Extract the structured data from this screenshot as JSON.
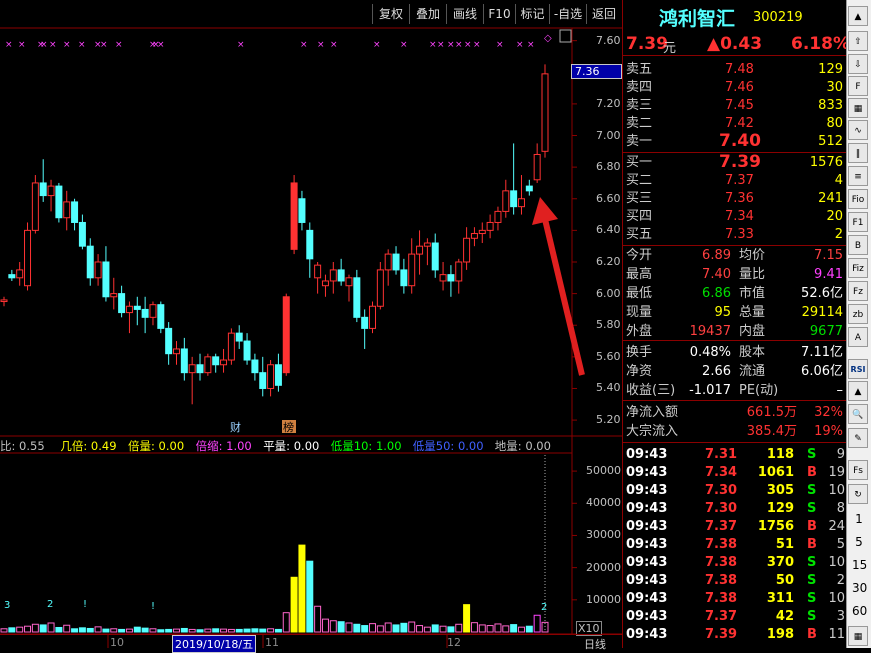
{
  "toolbar": {
    "buttons": [
      "复权",
      "叠加",
      "画线",
      "F10",
      "标记",
      "-自选",
      "返回"
    ]
  },
  "stock": {
    "name": "鸿利智汇",
    "code": "300219",
    "price": "7.39",
    "price_unit": "元",
    "change": "▲0.43",
    "change_pct": "6.18%"
  },
  "price_axis": {
    "ticks": [
      "7.60",
      "7.40",
      "7.20",
      "7.00",
      "6.80",
      "6.60",
      "6.40",
      "6.20",
      "6.00",
      "5.80",
      "5.60",
      "5.40",
      "5.20"
    ],
    "current_label": "7.36"
  },
  "volume_axis": {
    "ticks": [
      "50000",
      "40000",
      "30000",
      "20000",
      "10000"
    ],
    "unit": "X10"
  },
  "indicator_line": {
    "items": [
      {
        "label": "比: 0.55",
        "color": "#c0c0c0"
      },
      {
        "label": "几倍: 0.49",
        "color": "#ffff00"
      },
      {
        "label": "倍量: 0.00",
        "color": "#ffff00"
      },
      {
        "label": "倍缩: 1.00",
        "color": "#ff44ff"
      },
      {
        "label": "平量: 0.00",
        "color": "#ffffff"
      },
      {
        "label": "低量10: 1.00",
        "color": "#00ff00"
      },
      {
        "label": "低量50: 0.00",
        "color": "#4060ff"
      },
      {
        "label": "地量: 0.00",
        "color": "#c0c0c0"
      }
    ]
  },
  "chart_markers": {
    "cai": "财",
    "bang": "榜",
    "diamond": "◇",
    "vol_labels": [
      "3",
      "2",
      "!",
      "!",
      "2"
    ]
  },
  "date_axis": {
    "labels": [
      "10",
      "2019/10/18/五",
      "11",
      "12"
    ],
    "period": "日线"
  },
  "order_book": {
    "sell": [
      {
        "label": "卖五",
        "price": "7.48",
        "vol": "129"
      },
      {
        "label": "卖四",
        "price": "7.46",
        "vol": "30"
      },
      {
        "label": "卖三",
        "price": "7.45",
        "vol": "833"
      },
      {
        "label": "卖二",
        "price": "7.42",
        "vol": "80"
      },
      {
        "label": "卖一",
        "price": "7.40",
        "vol": "512"
      }
    ],
    "buy": [
      {
        "label": "买一",
        "price": "7.39",
        "vol": "1576"
      },
      {
        "label": "买二",
        "price": "7.37",
        "vol": "4"
      },
      {
        "label": "买三",
        "price": "7.36",
        "vol": "241"
      },
      {
        "label": "买四",
        "price": "7.34",
        "vol": "20"
      },
      {
        "label": "买五",
        "price": "7.33",
        "vol": "2"
      }
    ]
  },
  "stats": [
    {
      "l1": "今开",
      "v1": "6.89",
      "c1": "#ff4040",
      "l2": "均价",
      "v2": "7.15",
      "c2": "#ff4040"
    },
    {
      "l1": "最高",
      "v1": "7.40",
      "c1": "#ff4040",
      "l2": "量比",
      "v2": "9.41",
      "c2": "#ff40ff"
    },
    {
      "l1": "最低",
      "v1": "6.86",
      "c1": "#00e000",
      "l2": "市值",
      "v2": "52.6亿",
      "c2": "#ffffff"
    },
    {
      "l1": "现量",
      "v1": "95",
      "c1": "#ffff00",
      "l2": "总量",
      "v2": "29114",
      "c2": "#ffff00"
    },
    {
      "l1": "外盘",
      "v1": "19437",
      "c1": "#ff4040",
      "l2": "内盘",
      "v2": "9677",
      "c2": "#00e000"
    }
  ],
  "stats2": [
    {
      "l1": "换手",
      "v1": "0.48%",
      "l2": "股本",
      "v2": "7.11亿"
    },
    {
      "l1": "净资",
      "v1": "2.66",
      "l2": "流通",
      "v2": "6.06亿"
    },
    {
      "l1": "收益(三)",
      "v1": "-1.017",
      "l2": "PE(动)",
      "v2": "–"
    }
  ],
  "flows": [
    {
      "label": "净流入额",
      "value": "661.5万",
      "pct": "32%"
    },
    {
      "label": "大宗流入",
      "value": "385.4万",
      "pct": "19%"
    }
  ],
  "ticks": [
    {
      "time": "09:43",
      "price": "7.31",
      "vol": "118",
      "side": "S",
      "n": "9"
    },
    {
      "time": "09:43",
      "price": "7.34",
      "vol": "1061",
      "side": "B",
      "n": "19"
    },
    {
      "time": "09:43",
      "price": "7.30",
      "vol": "305",
      "side": "S",
      "n": "10"
    },
    {
      "time": "09:43",
      "price": "7.30",
      "vol": "129",
      "side": "S",
      "n": "8"
    },
    {
      "time": "09:43",
      "price": "7.37",
      "vol": "1756",
      "side": "B",
      "n": "24"
    },
    {
      "time": "09:43",
      "price": "7.38",
      "vol": "51",
      "side": "B",
      "n": "5"
    },
    {
      "time": "09:43",
      "price": "7.38",
      "vol": "370",
      "side": "S",
      "n": "10"
    },
    {
      "time": "09:43",
      "price": "7.38",
      "vol": "50",
      "side": "S",
      "n": "2"
    },
    {
      "time": "09:43",
      "price": "7.38",
      "vol": "311",
      "side": "S",
      "n": "10"
    },
    {
      "time": "09:43",
      "price": "7.37",
      "vol": "42",
      "side": "S",
      "n": "3"
    },
    {
      "time": "09:43",
      "price": "7.39",
      "vol": "198",
      "side": "B",
      "n": "11"
    }
  ],
  "side_nums": [
    "1",
    "5",
    "15",
    "30",
    "60"
  ],
  "colors": {
    "up": "#ff3232",
    "down": "#54ffff",
    "grid": "#8b0000",
    "arrow": "#e02020"
  },
  "chart_data": {
    "type": "candlestick",
    "ylim": [
      5.15,
      7.68
    ],
    "candles": [
      [
        5.95,
        5.98,
        5.92,
        5.96
      ],
      [
        6.12,
        6.15,
        6.08,
        6.1
      ],
      [
        6.1,
        6.2,
        6.05,
        6.15
      ],
      [
        6.05,
        6.45,
        6.02,
        6.4
      ],
      [
        6.4,
        6.75,
        6.38,
        6.7
      ],
      [
        6.7,
        6.85,
        6.58,
        6.62
      ],
      [
        6.62,
        6.72,
        6.52,
        6.68
      ],
      [
        6.68,
        6.7,
        6.45,
        6.48
      ],
      [
        6.48,
        6.65,
        6.4,
        6.58
      ],
      [
        6.58,
        6.6,
        6.4,
        6.45
      ],
      [
        6.45,
        6.5,
        6.28,
        6.3
      ],
      [
        6.3,
        6.35,
        6.05,
        6.1
      ],
      [
        6.1,
        6.25,
        6.05,
        6.2
      ],
      [
        6.2,
        6.3,
        5.95,
        5.98
      ],
      [
        5.98,
        6.1,
        5.9,
        6.0
      ],
      [
        6.0,
        6.05,
        5.85,
        5.88
      ],
      [
        5.88,
        5.95,
        5.75,
        5.92
      ],
      [
        5.92,
        5.98,
        5.8,
        5.9
      ],
      [
        5.9,
        5.98,
        5.75,
        5.85
      ],
      [
        5.85,
        5.95,
        5.8,
        5.93
      ],
      [
        5.93,
        5.95,
        5.75,
        5.78
      ],
      [
        5.78,
        5.82,
        5.55,
        5.62
      ],
      [
        5.62,
        5.7,
        5.55,
        5.65
      ],
      [
        5.65,
        5.72,
        5.45,
        5.5
      ],
      [
        5.5,
        5.6,
        5.3,
        5.55
      ],
      [
        5.55,
        5.62,
        5.45,
        5.5
      ],
      [
        5.5,
        5.62,
        5.48,
        5.6
      ],
      [
        5.6,
        5.62,
        5.5,
        5.55
      ],
      [
        5.55,
        5.65,
        5.5,
        5.58
      ],
      [
        5.58,
        5.78,
        5.55,
        5.75
      ],
      [
        5.75,
        5.8,
        5.65,
        5.7
      ],
      [
        5.7,
        5.75,
        5.55,
        5.58
      ],
      [
        5.58,
        5.62,
        5.45,
        5.5
      ],
      [
        5.5,
        5.6,
        5.35,
        5.4
      ],
      [
        5.4,
        5.58,
        5.35,
        5.55
      ],
      [
        5.55,
        5.62,
        5.38,
        5.42
      ],
      [
        5.5,
        6.0,
        5.48,
        5.98
      ],
      [
        6.28,
        6.75,
        6.25,
        6.7
      ],
      [
        6.6,
        6.65,
        6.4,
        6.45
      ],
      [
        6.4,
        6.45,
        6.1,
        6.22
      ],
      [
        6.1,
        6.2,
        6.0,
        6.18
      ],
      [
        6.05,
        6.12,
        5.98,
        6.08
      ],
      [
        6.08,
        6.2,
        6.0,
        6.15
      ],
      [
        6.15,
        6.22,
        6.05,
        6.08
      ],
      [
        6.05,
        6.12,
        5.95,
        6.1
      ],
      [
        6.1,
        6.15,
        5.82,
        5.85
      ],
      [
        5.85,
        5.9,
        5.65,
        5.78
      ],
      [
        5.78,
        5.95,
        5.75,
        5.92
      ],
      [
        5.92,
        6.2,
        5.9,
        6.15
      ],
      [
        6.15,
        6.28,
        6.05,
        6.25
      ],
      [
        6.25,
        6.3,
        6.12,
        6.15
      ],
      [
        6.15,
        6.22,
        6.0,
        6.05
      ],
      [
        6.05,
        6.35,
        6.0,
        6.25
      ],
      [
        6.25,
        6.4,
        6.12,
        6.3
      ],
      [
        6.3,
        6.35,
        6.18,
        6.32
      ],
      [
        6.32,
        6.38,
        6.1,
        6.15
      ],
      [
        6.08,
        6.2,
        6.02,
        6.12
      ],
      [
        6.12,
        6.18,
        5.98,
        6.08
      ],
      [
        6.08,
        6.22,
        6.0,
        6.2
      ],
      [
        6.2,
        6.42,
        6.15,
        6.35
      ],
      [
        6.35,
        6.42,
        6.3,
        6.38
      ],
      [
        6.38,
        6.45,
        6.32,
        6.4
      ],
      [
        6.4,
        6.5,
        6.35,
        6.45
      ],
      [
        6.45,
        6.55,
        6.4,
        6.52
      ],
      [
        6.52,
        6.72,
        6.48,
        6.65
      ],
      [
        6.65,
        6.95,
        6.5,
        6.55
      ],
      [
        6.55,
        6.75,
        6.5,
        6.6
      ],
      [
        6.68,
        6.72,
        6.62,
        6.65
      ],
      [
        6.72,
        6.95,
        6.7,
        6.88
      ],
      [
        6.9,
        7.45,
        6.86,
        7.39
      ]
    ],
    "volumes": [
      1,
      1.3,
      1.5,
      1.8,
      2.4,
      2.2,
      2.8,
      1.4,
      2.1,
      1.0,
      1.3,
      1.1,
      1.6,
      0.9,
      1.0,
      0.8,
      0.9,
      1.5,
      1.2,
      1.0,
      0.7,
      0.8,
      0.9,
      1.1,
      0.8,
      0.7,
      0.9,
      1.0,
      0.9,
      0.8,
      0.8,
      0.9,
      1.0,
      0.9,
      1.0,
      0.8,
      6.0,
      17.0,
      27.0,
      22.0,
      8.0,
      4.0,
      3.5,
      3.2,
      2.8,
      2.4,
      2.0,
      2.6,
      1.9,
      2.8,
      2.2,
      2.7,
      3.1,
      2.0,
      1.5,
      2.2,
      1.8,
      1.6,
      2.4,
      8.5,
      2.9,
      2.2,
      2.0,
      2.5,
      1.9,
      2.3,
      1.5,
      1.8,
      5.2,
      3.0
    ],
    "vol_ylim": [
      0,
      55000
    ],
    "series": [
      {
        "name": "K线"
      }
    ]
  }
}
